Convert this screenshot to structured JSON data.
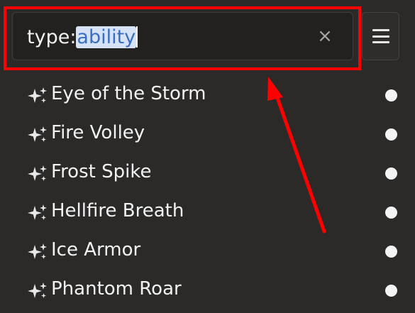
{
  "search": {
    "prefix": "type:",
    "selected": "ability",
    "clear_symbol": "×"
  },
  "menu": {
    "icon": "hamburger-menu-icon"
  },
  "items": [
    {
      "label": "Eye of the Storm",
      "icon": "sparkle-icon"
    },
    {
      "label": "Fire Volley",
      "icon": "sparkle-icon"
    },
    {
      "label": "Frost Spike",
      "icon": "sparkle-icon"
    },
    {
      "label": "Hellfire Breath",
      "icon": "sparkle-icon"
    },
    {
      "label": "Ice Armor",
      "icon": "sparkle-icon"
    },
    {
      "label": "Phantom Roar",
      "icon": "sparkle-icon"
    }
  ],
  "colors": {
    "background": "#2b2a29",
    "annotation": "#ff0000",
    "selection_bg": "#d6e2f6",
    "selection_text": "#3a6ec2"
  }
}
